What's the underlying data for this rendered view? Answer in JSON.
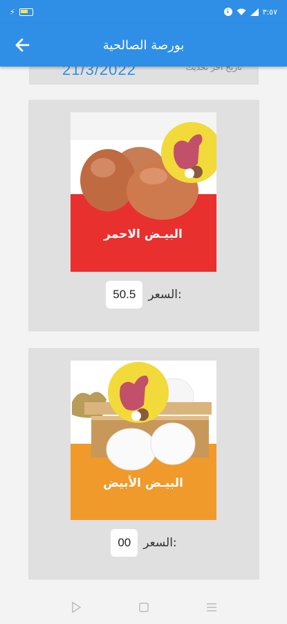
{
  "status_bar": {
    "time": "٣:٥٧"
  },
  "app_bar": {
    "title": "بورصة الصالحية",
    "back_icon": "arrow-left-icon"
  },
  "date_card": {
    "label": "تاريخ آخر تحديث",
    "value": "21/3/2022"
  },
  "products": [
    {
      "banner_label": "البيـض الاحمر",
      "banner_color": "#e8302f",
      "price_label": "السعر:",
      "price_value": "50.5"
    },
    {
      "banner_label": "البيـض الأبيض",
      "banner_color": "#ef9a2a",
      "price_label": "السعر:",
      "price_value": "00"
    }
  ],
  "nav_bar": {
    "icons": [
      "back-triangle-icon",
      "home-square-icon",
      "recents-menu-icon"
    ]
  }
}
